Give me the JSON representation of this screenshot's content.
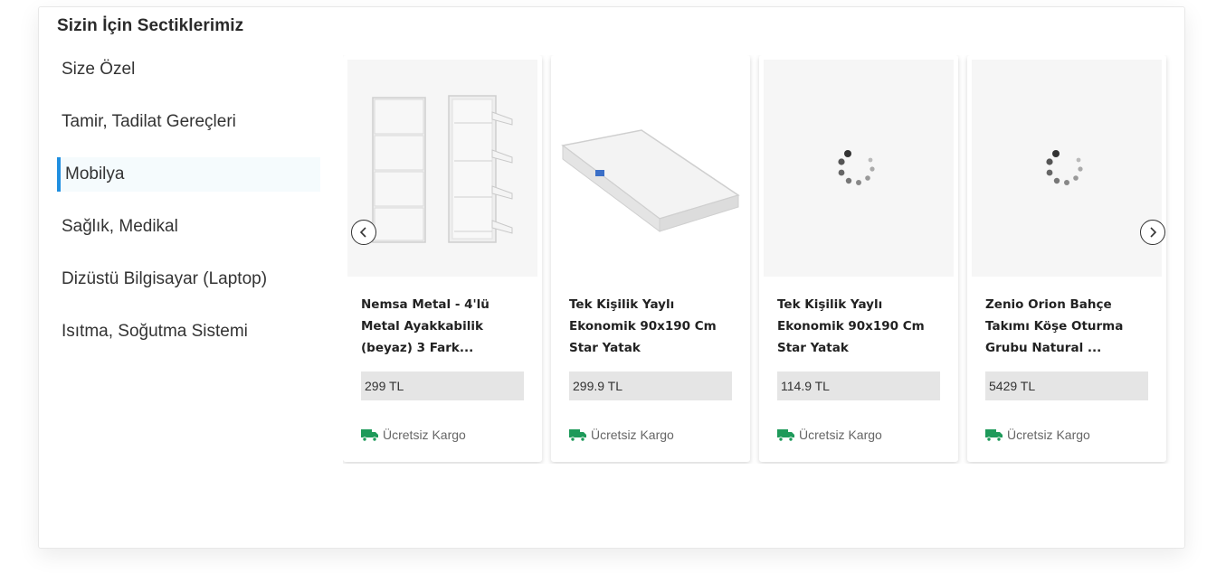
{
  "section": {
    "title": "Sizin İçin Sectiklerimiz"
  },
  "categories": [
    {
      "label": "Size Özel",
      "active": false
    },
    {
      "label": "Tamir, Tadilat Gereçleri",
      "active": false
    },
    {
      "label": "Mobilya",
      "active": true
    },
    {
      "label": "Sağlık, Medikal",
      "active": false
    },
    {
      "label": "Dizüstü Bilgisayar (Laptop)",
      "active": false
    },
    {
      "label": "Isıtma, Soğutma Sistemi",
      "active": false
    }
  ],
  "products": [
    {
      "name": "Nemsa Metal - 4'lü Metal Ayakkabilik (beyaz) 3 Fark...",
      "price": "299 TL",
      "shipping": "Ücretsiz Kargo",
      "image": "shoe-cabinet-image"
    },
    {
      "name": "Tek Kişilik Yaylı Ekonomik 90x190 Cm Star Yatak",
      "price": "299.9 TL",
      "shipping": "Ücretsiz Kargo",
      "image": "mattress-image"
    },
    {
      "name": "Tek Kişilik Yaylı Ekonomik 90x190 Cm Star Yatak",
      "price": "114.9 TL",
      "shipping": "Ücretsiz Kargo",
      "image": "loading-spinner"
    },
    {
      "name": "Zenio Orion Bahçe Takımı Köşe Oturma Grubu Natural ...",
      "price": "5429 TL",
      "shipping": "Ücretsiz Kargo",
      "image": "loading-spinner"
    }
  ],
  "colors": {
    "accent": "#1f8fe0",
    "shipping_icon": "#1e9a5a"
  },
  "icons": {
    "prev": "chevron-left-icon",
    "next": "chevron-right-icon",
    "shipping": "truck-icon"
  }
}
